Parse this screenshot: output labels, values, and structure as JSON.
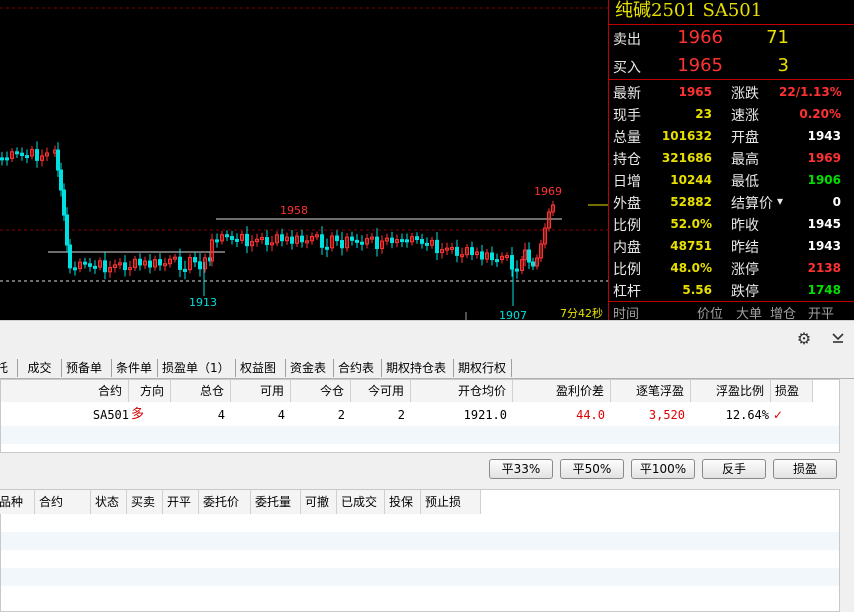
{
  "chart": {
    "labels": {
      "high": "1958",
      "low_left": "1913",
      "peak": "1969",
      "low_right": "1907",
      "timer": "7分42秒"
    }
  },
  "quote": {
    "title": "纯碱2501  SA501",
    "sell": {
      "label": "卖出",
      "price": "1966",
      "volume": "71"
    },
    "buy": {
      "label": "买入",
      "price": "1965",
      "volume": "3"
    },
    "rows": [
      {
        "l1": "最新",
        "v1": "1965",
        "c1": "red",
        "l2": "涨跌",
        "v2": "22/1.13%",
        "c2": "red"
      },
      {
        "l1": "现手",
        "v1": "23",
        "c1": "yel",
        "l2": "速涨",
        "v2": "0.20%",
        "c2": "red"
      },
      {
        "l1": "总量",
        "v1": "101632",
        "c1": "yel",
        "l2": "开盘",
        "v2": "1943",
        "c2": "wht"
      },
      {
        "l1": "持仓",
        "v1": "321686",
        "c1": "yel",
        "l2": "最高",
        "v2": "1969",
        "c2": "red"
      },
      {
        "l1": "日增",
        "v1": "10244",
        "c1": "yel",
        "l2": "最低",
        "v2": "1906",
        "c2": "grn"
      },
      {
        "l1": "外盘",
        "v1": "52882",
        "c1": "yel",
        "l2": "结算价",
        "v2": "0",
        "c2": "wht"
      },
      {
        "l1": "比例",
        "v1": "52.0%",
        "c1": "yel",
        "l2": "昨收",
        "v2": "1945",
        "c2": "wht"
      },
      {
        "l1": "内盘",
        "v1": "48751",
        "c1": "yel",
        "l2": "昨结",
        "v2": "1943",
        "c2": "wht"
      },
      {
        "l1": "比例",
        "v1": "48.0%",
        "c1": "yel",
        "l2": "涨停",
        "v2": "2138",
        "c2": "red"
      },
      {
        "l1": "杠杆",
        "v1": "5.56",
        "c1": "yel",
        "l2": "跌停",
        "v2": "1748",
        "c2": "grn"
      }
    ],
    "ticks_header": [
      "时间",
      "价位",
      "大单",
      "增仓",
      "开平"
    ]
  },
  "tabs": [
    "托",
    "成交",
    "预备单",
    "条件单",
    "损盈单（1）",
    "权益图",
    "资金表",
    "合约表",
    "期权持仓表",
    "期权行权"
  ],
  "positions": {
    "headers": [
      "合约",
      "方向",
      "总仓",
      "可用",
      "今仓",
      "今可用",
      "开仓均价",
      "盈利价差",
      "逐笔浮盈",
      "浮盈比例",
      "损盈"
    ],
    "row": {
      "contract": "SA501",
      "direction": "多",
      "total": "4",
      "available": "4",
      "today": "2",
      "today_available": "2",
      "open_avg": "1921.0",
      "profit_spread": "44.0",
      "float_pnl": "3,520",
      "float_ratio": "12.64%",
      "stop": "✓"
    }
  },
  "actions": [
    "平33%",
    "平50%",
    "平100%",
    "反手",
    "损盈"
  ],
  "orders": {
    "headers": [
      "品种",
      "合约",
      "状态",
      "买卖",
      "开平",
      "委托价",
      "委托量",
      "可撤",
      "已成交",
      "投保",
      "预止损"
    ]
  },
  "colors": {
    "up": "#ff3232",
    "down": "#00e0e0",
    "accent": "#e8e000",
    "border": "#c00000"
  }
}
